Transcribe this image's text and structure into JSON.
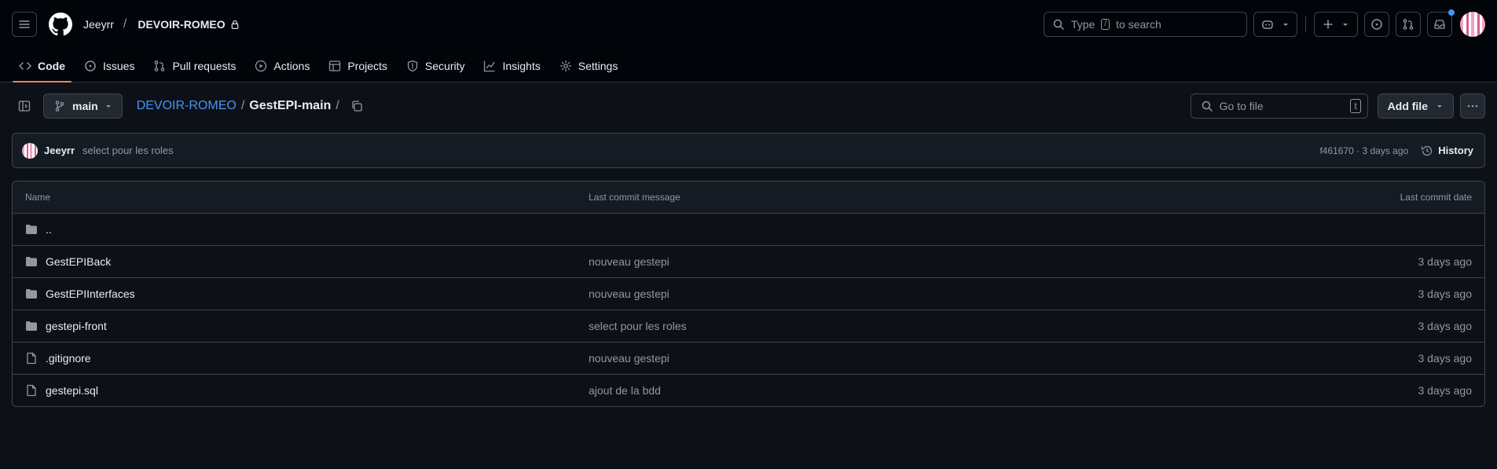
{
  "header": {
    "owner": "Jeeyrr",
    "repo": "DEVOIR-ROMEO",
    "search": {
      "prefix": "Type",
      "key": "/",
      "suffix": "to search"
    }
  },
  "tabs": [
    {
      "label": "Code",
      "icon": "code-icon",
      "active": true
    },
    {
      "label": "Issues",
      "icon": "issue-icon"
    },
    {
      "label": "Pull requests",
      "icon": "pull-request-icon"
    },
    {
      "label": "Actions",
      "icon": "play-icon"
    },
    {
      "label": "Projects",
      "icon": "table-icon"
    },
    {
      "label": "Security",
      "icon": "shield-icon"
    },
    {
      "label": "Insights",
      "icon": "graph-icon"
    },
    {
      "label": "Settings",
      "icon": "gear-icon"
    }
  ],
  "path": {
    "branch": "main",
    "repo_link": "DEVOIR-ROMEO",
    "sep": "/",
    "current": "GestEPI-main",
    "goto_placeholder": "Go to file",
    "goto_key": "t",
    "add_file": "Add file"
  },
  "commit": {
    "author": "Jeeyrr",
    "message": "select pour les roles",
    "meta": "f461670 · 3 days ago",
    "history": "History"
  },
  "table": {
    "headers": {
      "name": "Name",
      "message": "Last commit message",
      "date": "Last commit date"
    },
    "parent": "..",
    "rows": [
      {
        "name": "GestEPIBack",
        "type": "folder",
        "message": "nouveau gestepi",
        "date": "3 days ago"
      },
      {
        "name": "GestEPIInterfaces",
        "type": "folder",
        "message": "nouveau gestepi",
        "date": "3 days ago"
      },
      {
        "name": "gestepi-front",
        "type": "folder",
        "message": "select pour les roles",
        "date": "3 days ago"
      },
      {
        "name": ".gitignore",
        "type": "file",
        "message": "nouveau gestepi",
        "date": "3 days ago"
      },
      {
        "name": "gestepi.sql",
        "type": "file",
        "message": "ajout de la bdd",
        "date": "3 days ago"
      }
    ]
  },
  "colors": {
    "link": "#4493f8",
    "tab_underline": "#f78166",
    "notification_dot": "#4493f8"
  }
}
